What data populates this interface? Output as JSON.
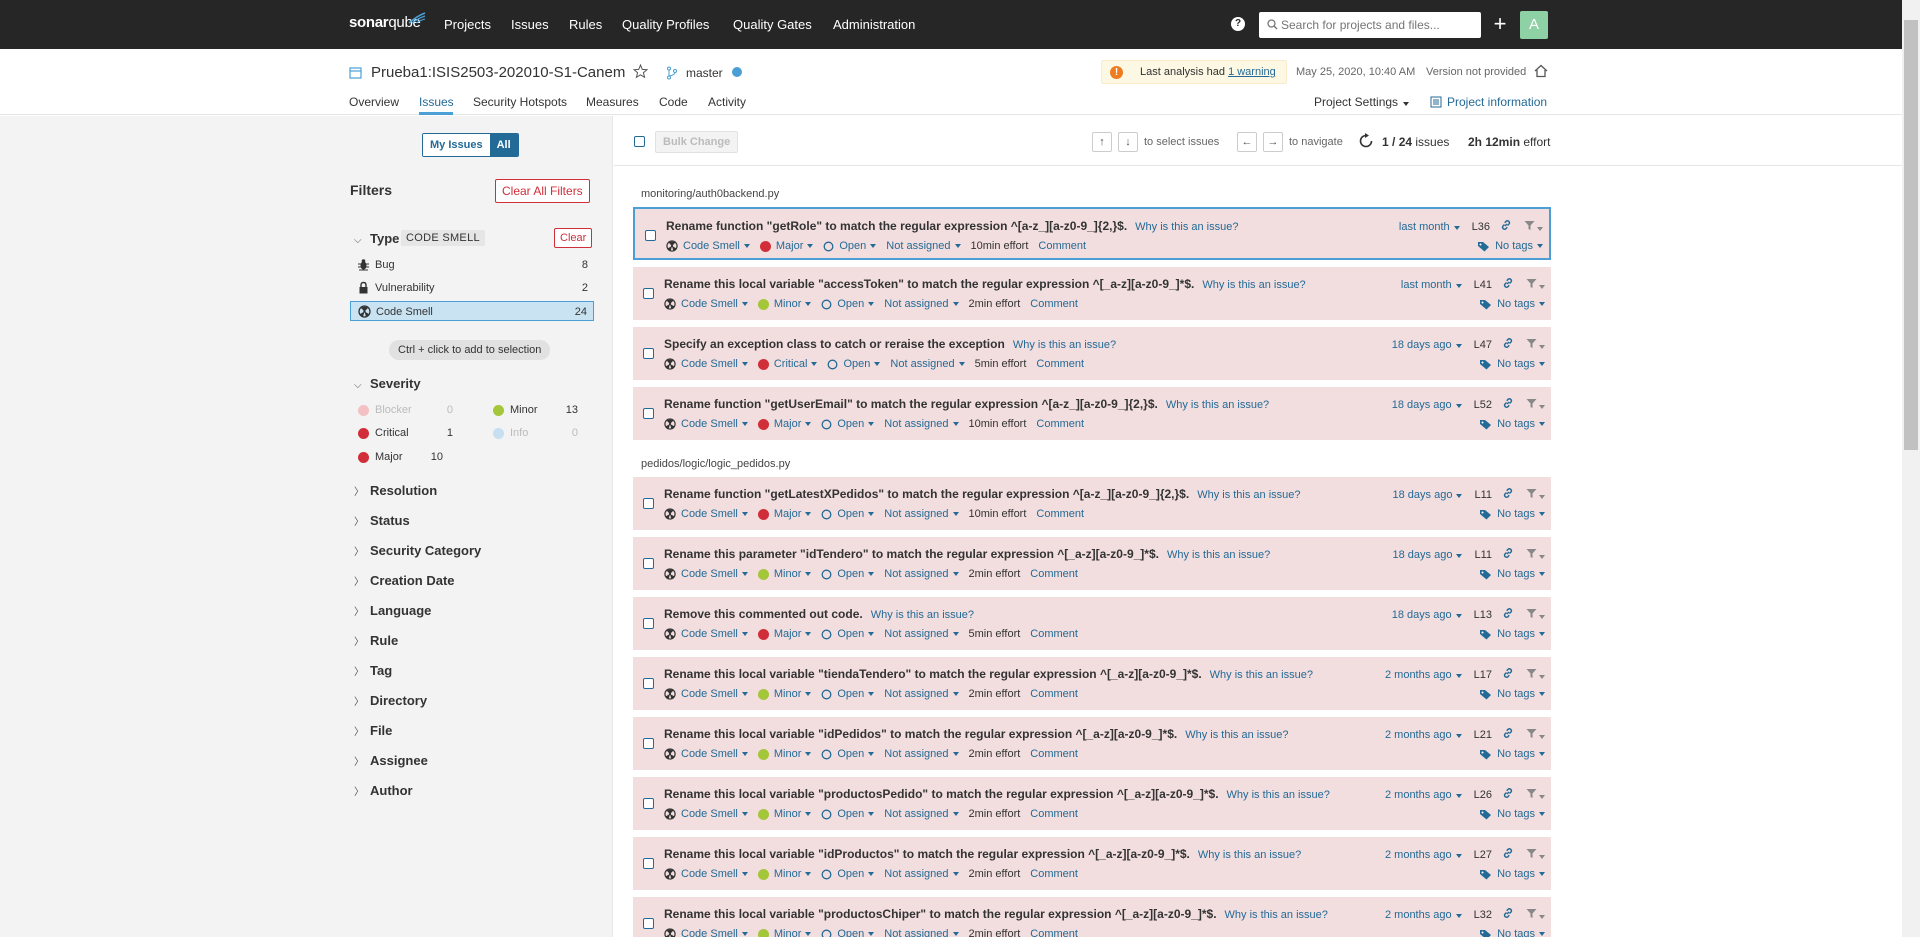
{
  "topnav": {
    "logo_sonar": "sonar",
    "logo_qube": "qube",
    "items": [
      "Projects",
      "Issues",
      "Rules",
      "Quality Profiles",
      "Quality Gates",
      "Administration"
    ],
    "search_placeholder": "Search for projects and files...",
    "avatar_letter": "A"
  },
  "project": {
    "name": "Prueba1:ISIS2503-202010-S1-Canem",
    "branch": "master",
    "warning_prefix": "Last analysis had",
    "warning_link": "1 warning",
    "analysis_date": "May 25, 2020, 10:40 AM",
    "version": "Version not provided",
    "tabs": [
      "Overview",
      "Issues",
      "Security Hotspots",
      "Measures",
      "Code",
      "Activity"
    ],
    "settings_label": "Project Settings",
    "info_label": "Project information"
  },
  "sidebar": {
    "my_issues": "My Issues",
    "all": "All",
    "filters_title": "Filters",
    "clear_all": "Clear All Filters",
    "type": {
      "title": "Type",
      "badge": "CODE SMELL",
      "clear": "Clear",
      "rows": [
        {
          "label": "Bug",
          "count": "8"
        },
        {
          "label": "Vulnerability",
          "count": "2"
        },
        {
          "label": "Code Smell",
          "count": "24"
        }
      ]
    },
    "ctrl_hint": "Ctrl + click to add to selection",
    "severity": {
      "title": "Severity",
      "blocker": {
        "label": "Blocker",
        "count": "0"
      },
      "minor": {
        "label": "Minor",
        "count": "13"
      },
      "critical": {
        "label": "Critical",
        "count": "1"
      },
      "info": {
        "label": "Info",
        "count": "0"
      },
      "major": {
        "label": "Major",
        "count": "10"
      }
    },
    "facets": [
      "Resolution",
      "Status",
      "Security Category",
      "Creation Date",
      "Language",
      "Rule",
      "Tag",
      "Directory",
      "File",
      "Assignee",
      "Author"
    ]
  },
  "toolbar": {
    "bulk_change": "Bulk Change",
    "up_key": "↑",
    "down_key": "↓",
    "select_text": "to select issues",
    "left_key": "←",
    "right_key": "→",
    "navigate_text": "to navigate",
    "current": "1",
    "total": "/ 24",
    "issues_word": "issues",
    "effort_value": "2h 12min",
    "effort_word": "effort"
  },
  "labels": {
    "why": "Why is this an issue?",
    "comment": "Comment",
    "no_tags": "No tags",
    "code_smell": "Code Smell",
    "open": "Open",
    "not_assigned": "Not assigned"
  },
  "files": [
    "monitoring/auth0backend.py",
    "pedidos/logic/logic_pedidos.py"
  ],
  "issues": [
    {
      "msg": "Rename function \"getRole\" to match the regular expression ^[a-z_][a-z0-9_]{2,}$.",
      "sev": "Major",
      "effort": "10min effort",
      "age": "last month",
      "line": "L36"
    },
    {
      "msg": "Rename this local variable \"accessToken\" to match the regular expression ^[_a-z][a-z0-9_]*$.",
      "sev": "Minor",
      "effort": "2min effort",
      "age": "last month",
      "line": "L41"
    },
    {
      "msg": "Specify an exception class to catch or reraise the exception",
      "sev": "Critical",
      "effort": "5min effort",
      "age": "18 days ago",
      "line": "L47"
    },
    {
      "msg": "Rename function \"getUserEmail\" to match the regular expression ^[a-z_][a-z0-9_]{2,}$.",
      "sev": "Major",
      "effort": "10min effort",
      "age": "18 days ago",
      "line": "L52"
    },
    {
      "msg": "Rename function \"getLatestXPedidos\" to match the regular expression ^[a-z_][a-z0-9_]{2,}$.",
      "sev": "Major",
      "effort": "10min effort",
      "age": "18 days ago",
      "line": "L11"
    },
    {
      "msg": "Rename this parameter \"idTendero\" to match the regular expression ^[_a-z][a-z0-9_]*$.",
      "sev": "Minor",
      "effort": "2min effort",
      "age": "18 days ago",
      "line": "L11"
    },
    {
      "msg": "Remove this commented out code.",
      "sev": "Major",
      "effort": "5min effort",
      "age": "18 days ago",
      "line": "L13"
    },
    {
      "msg": "Rename this local variable \"tiendaTendero\" to match the regular expression ^[_a-z][a-z0-9_]*$.",
      "sev": "Minor",
      "effort": "2min effort",
      "age": "2 months ago",
      "line": "L17"
    },
    {
      "msg": "Rename this local variable \"idPedidos\" to match the regular expression ^[_a-z][a-z0-9_]*$.",
      "sev": "Minor",
      "effort": "2min effort",
      "age": "2 months ago",
      "line": "L21"
    },
    {
      "msg": "Rename this local variable \"productosPedido\" to match the regular expression ^[_a-z][a-z0-9_]*$.",
      "sev": "Minor",
      "effort": "2min effort",
      "age": "2 months ago",
      "line": "L26"
    },
    {
      "msg": "Rename this local variable \"idProductos\" to match the regular expression ^[_a-z][a-z0-9_]*$.",
      "sev": "Minor",
      "effort": "2min effort",
      "age": "2 months ago",
      "line": "L27"
    },
    {
      "msg": "Rename this local variable \"productosChiper\" to match the regular expression ^[_a-z][a-z0-9_]*$.",
      "sev": "Minor",
      "effort": "2min effort",
      "age": "2 months ago",
      "line": "L32"
    }
  ]
}
